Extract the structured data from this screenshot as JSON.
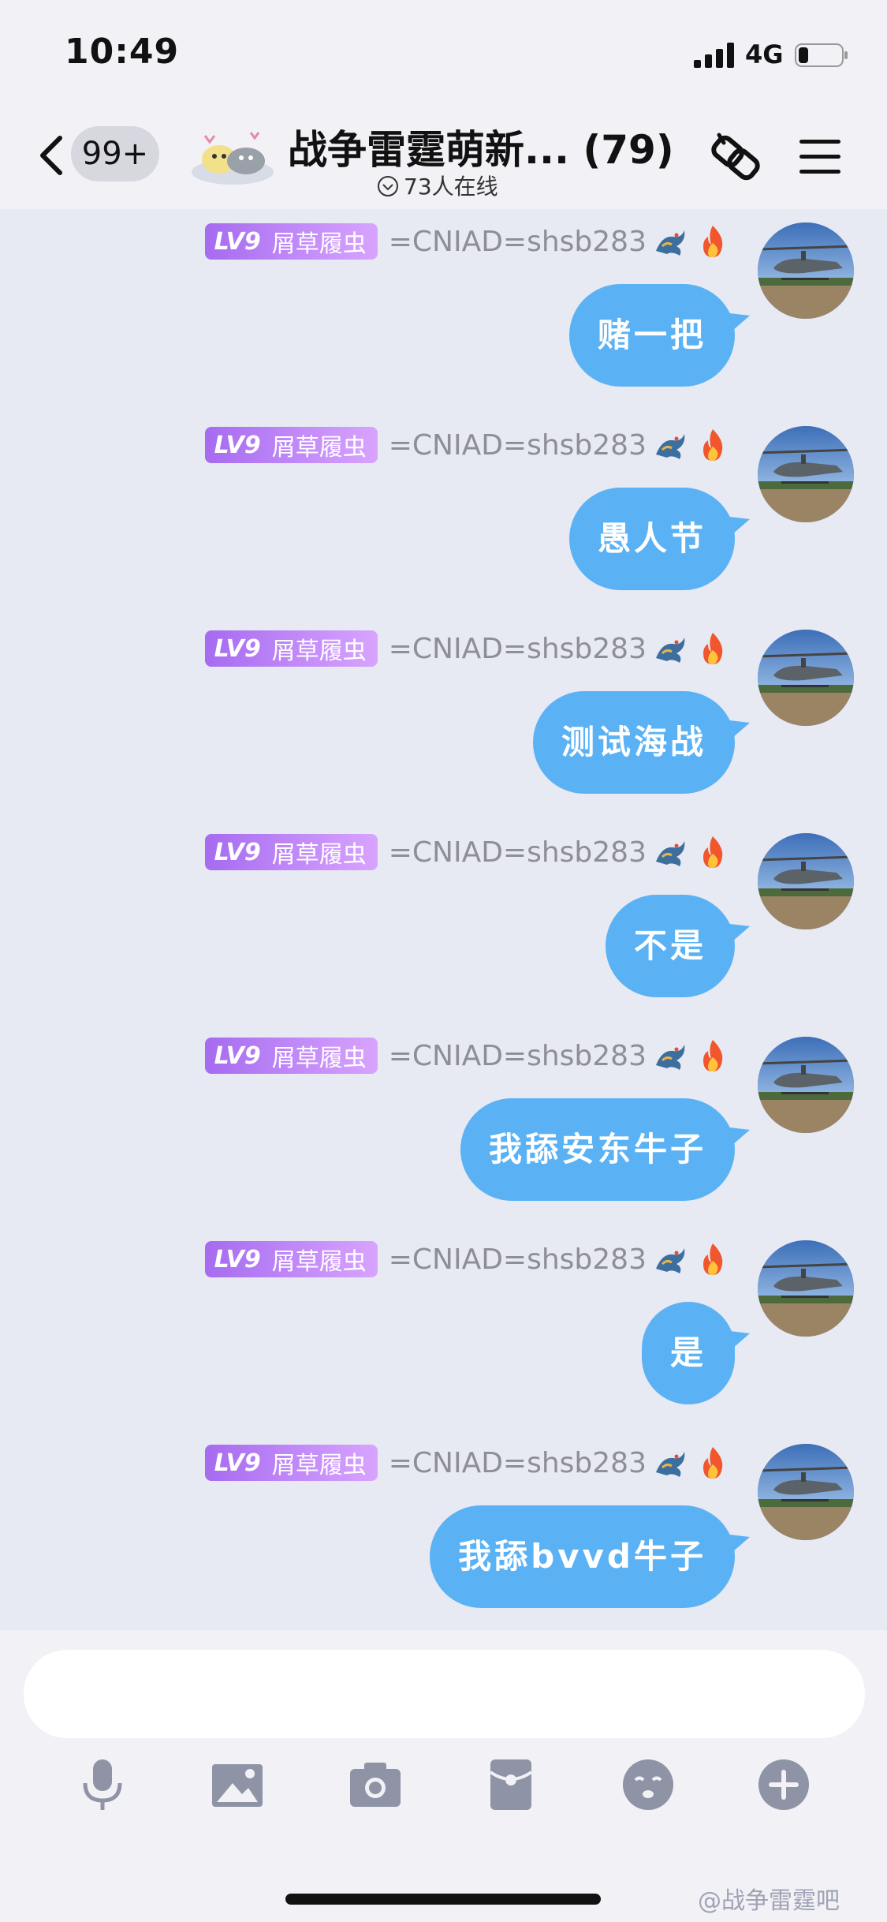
{
  "status": {
    "time": "10:49",
    "network": "4G"
  },
  "header": {
    "back_badge": "99+",
    "title": "战争雷霆萌新... (79)",
    "online": "73人在线"
  },
  "messages": [
    {
      "level": "LV9",
      "tag_name": "屑草履虫",
      "username": "=CNIAD=shsb283",
      "text": "赌一把"
    },
    {
      "level": "LV9",
      "tag_name": "屑草履虫",
      "username": "=CNIAD=shsb283",
      "text": "愚人节"
    },
    {
      "level": "LV9",
      "tag_name": "屑草履虫",
      "username": "=CNIAD=shsb283",
      "text": "测试海战"
    },
    {
      "level": "LV9",
      "tag_name": "屑草履虫",
      "username": "=CNIAD=shsb283",
      "text": "不是"
    },
    {
      "level": "LV9",
      "tag_name": "屑草履虫",
      "username": "=CNIAD=shsb283",
      "text": "我舔安东牛子"
    },
    {
      "level": "LV9",
      "tag_name": "屑草履虫",
      "username": "=CNIAD=shsb283",
      "text": "是"
    },
    {
      "level": "LV9",
      "tag_name": "屑草履虫",
      "username": "=CNIAD=shsb283",
      "text": "我舔bvvd牛子"
    }
  ],
  "input": {
    "placeholder": ""
  },
  "toolbar": [
    "microphone-icon",
    "image-icon",
    "camera-icon",
    "red-packet-icon",
    "emoji-icon",
    "plus-icon"
  ],
  "watermark": "@战争雷霆吧",
  "colors": {
    "bubble": "#5ab2f5",
    "level_tag": "#b77cf5",
    "background": "#e7e9f3"
  }
}
